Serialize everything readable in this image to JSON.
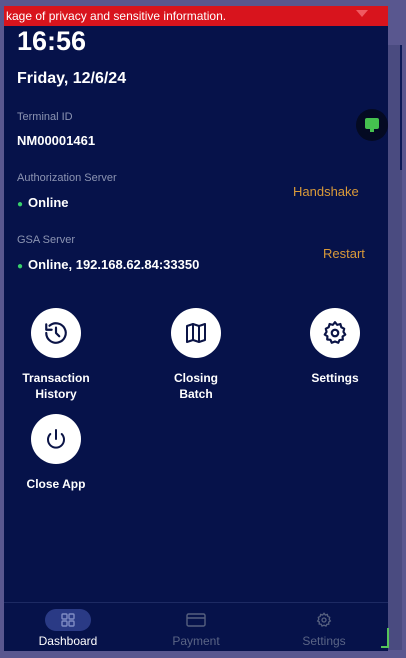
{
  "banner": {
    "text": "kage of privacy and sensitive information."
  },
  "clock": {
    "time": "16:56",
    "date": "Friday, 12/6/24"
  },
  "terminal": {
    "label": "Terminal ID",
    "value": "NM00001461"
  },
  "auth_server": {
    "label": "Authorization Server",
    "status": "Online",
    "action": "Handshake"
  },
  "gsa_server": {
    "label": "GSA Server",
    "status": "Online, 192.168.62.84:33350",
    "action": "Restart"
  },
  "tiles": {
    "transaction_history": "Transaction\nHistory",
    "closing_batch": "Closing\nBatch",
    "settings": "Settings",
    "close_app": "Close App"
  },
  "nav": {
    "dashboard": "Dashboard",
    "payment": "Payment",
    "settings": "Settings"
  },
  "colors": {
    "background": "#06124a",
    "banner": "#d8141d",
    "action": "#d99a39",
    "online_dot": "#37d06b",
    "terminal_badge": "#45c04f"
  },
  "icons": {
    "banner": "signal-icon",
    "terminal": "monitor-icon",
    "transaction_history": "history-icon",
    "closing_batch": "book-icon",
    "settings": "gear-icon",
    "close_app": "power-icon",
    "nav_dashboard": "grid-icon",
    "nav_payment": "card-icon",
    "nav_settings": "gear-icon"
  }
}
